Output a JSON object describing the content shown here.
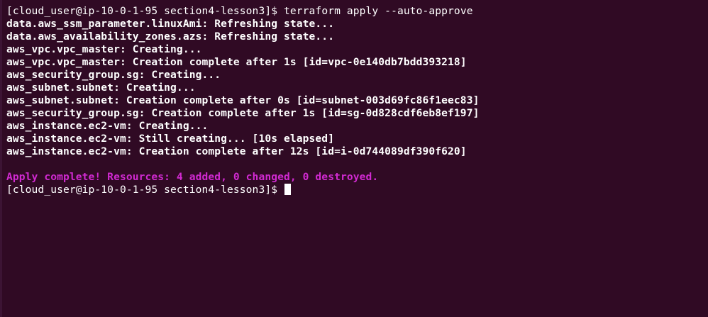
{
  "terminal": {
    "colors": {
      "background": "#300a24",
      "text": "#ffffff",
      "success": "#d12ad1"
    },
    "command_line": {
      "prompt": "[cloud_user@ip-10-0-1-95 section4-lesson3]$ ",
      "command": "terraform apply --auto-approve"
    },
    "output_lines": [
      "data.aws_ssm_parameter.linuxAmi: Refreshing state...",
      "data.aws_availability_zones.azs: Refreshing state...",
      "aws_vpc.vpc_master: Creating...",
      "aws_vpc.vpc_master: Creation complete after 1s [id=vpc-0e140db7bdd393218]",
      "aws_security_group.sg: Creating...",
      "aws_subnet.subnet: Creating...",
      "aws_subnet.subnet: Creation complete after 0s [id=subnet-003d69fc86f1eec83]",
      "aws_security_group.sg: Creation complete after 1s [id=sg-0d828cdf6eb8ef197]",
      "aws_instance.ec2-vm: Creating...",
      "aws_instance.ec2-vm: Still creating... [10s elapsed]",
      "aws_instance.ec2-vm: Creation complete after 12s [id=i-0d744089df390f620]"
    ],
    "summary": "Apply complete! Resources: 4 added, 0 changed, 0 destroyed.",
    "final_prompt": "[cloud_user@ip-10-0-1-95 section4-lesson3]$ "
  }
}
